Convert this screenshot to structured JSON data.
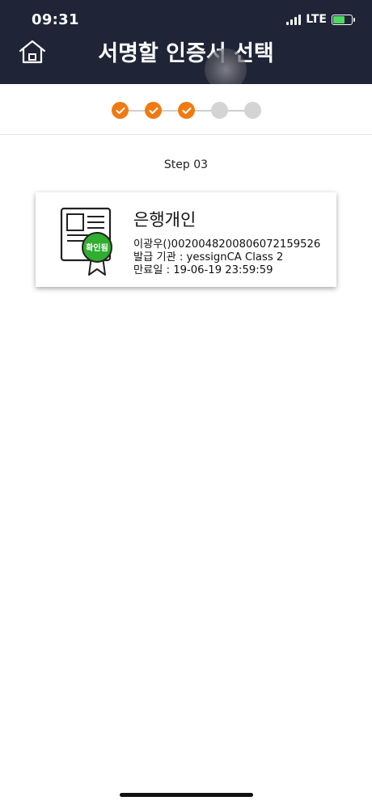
{
  "status_bar": {
    "time": "09:31",
    "network": "LTE"
  },
  "header": {
    "title": "서명할 인증서 선택"
  },
  "stepper": {
    "steps": [
      "done",
      "done",
      "done",
      "todo",
      "todo"
    ]
  },
  "step_label": "Step 03",
  "certificate": {
    "name": "은행개인",
    "badge": "확인됨",
    "subject": "이광우()0020048200806072159526",
    "issuer": "발급 기관 : yessignCA Class 2",
    "expiry": "만료일 : 19-06-19 23:59:59"
  },
  "colors": {
    "header_bg": "#1f2437",
    "step_done": "#f07a12",
    "step_todo": "#d4d4d4",
    "badge_green": "#2fae2f"
  },
  "icons": [
    "home-icon",
    "check-icon",
    "certificate-icon",
    "signal-icon",
    "battery-icon"
  ]
}
